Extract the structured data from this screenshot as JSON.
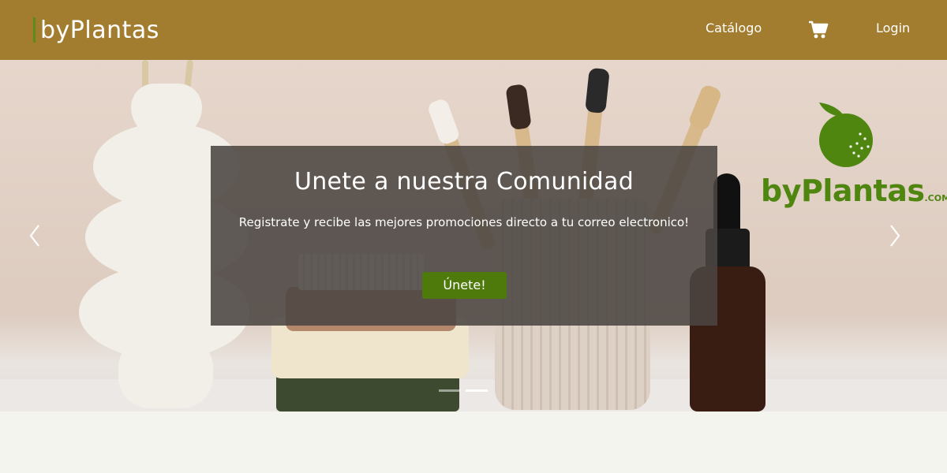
{
  "navbar": {
    "brand": "byPlantas",
    "links": {
      "catalog": "Catálogo",
      "login": "Login"
    },
    "cart_icon": "shopping-cart-icon"
  },
  "hero": {
    "logo": {
      "brand": "byPlantas",
      "suffix": ".COM",
      "icon": "apple-icon"
    },
    "caption": {
      "title": "Unete a nuestra Comunidad",
      "subtitle": "Registrate y recibe las mejores promociones directo a tu correo electronico!",
      "button": "Únete!"
    },
    "slide_count": 2,
    "active_slide": 2
  },
  "colors": {
    "navbar_bg": "#a37d2f",
    "accent_green": "#4e7a0b",
    "logo_green": "#4e860f",
    "page_bg": "#f4f4ef"
  }
}
